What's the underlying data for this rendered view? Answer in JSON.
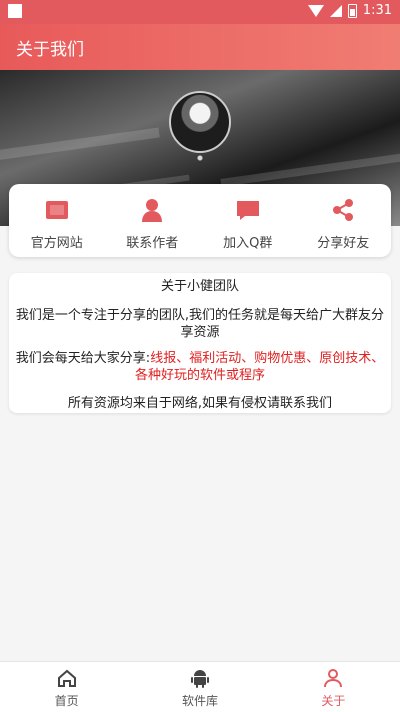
{
  "status_bar": {
    "time": "1:31"
  },
  "app_bar": {
    "title": "关于我们"
  },
  "actions": [
    {
      "label": "官方网站",
      "icon": "website-icon"
    },
    {
      "label": "联系作者",
      "icon": "person-icon"
    },
    {
      "label": "加入Q群",
      "icon": "chat-icon"
    },
    {
      "label": "分享好友",
      "icon": "share-icon"
    }
  ],
  "about": {
    "heading": "关于小健团队",
    "paragraph1": "我们是一个专注于分享的团队,我们的任务就是每天给广大群友分享资源",
    "paragraph2_prefix": "我们会每天给大家分享:",
    "paragraph2_highlight": "线报、福利活动、购物优惠、原创技术、各种好玩的软件或程序",
    "paragraph3": "所有资源均来自于网络,如果有侵权请联系我们"
  },
  "tabs": [
    {
      "label": "首页",
      "icon": "home-icon"
    },
    {
      "label": "软件库",
      "icon": "android-icon"
    },
    {
      "label": "关于",
      "icon": "user-icon",
      "active": true
    }
  ],
  "colors": {
    "accent": "#e25a5e",
    "highlight_text": "#e02020"
  }
}
